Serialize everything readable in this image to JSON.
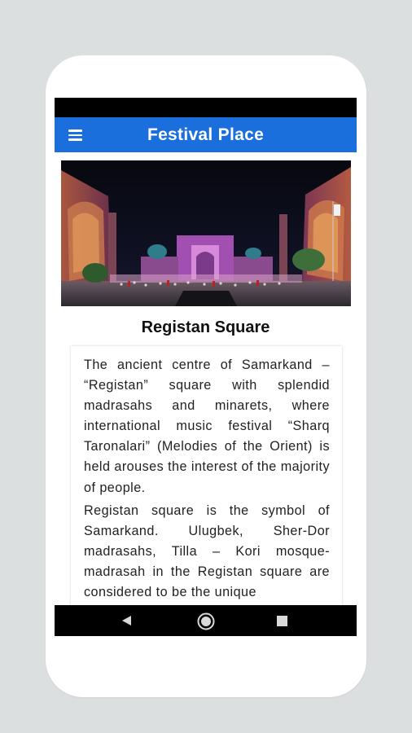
{
  "app_bar": {
    "title": "Festival Place",
    "menu_icon": "hamburger-menu-icon",
    "color": "#1a6fdc"
  },
  "hero_image": {
    "description_icon": "registan-square-photo"
  },
  "place": {
    "title": "Registan Square",
    "paragraphs": [
      "The ancient centre of Samarkand – “Registan” square with splendid madrasahs and minarets, where international music festival “Sharq Taronalari” (Melodies of the Orient) is held arouses the interest of the majority of people.",
      "Registan square is the symbol of Samarkand. Ulugbek, Sher-Dor madrasahs, Tilla – Kori mosque-madrasah in the Registan square are considered to be the unique"
    ]
  },
  "nav_bar": {
    "back_icon": "back-triangle-icon",
    "home_icon": "home-circle-icon",
    "recents_icon": "recents-square-icon"
  }
}
